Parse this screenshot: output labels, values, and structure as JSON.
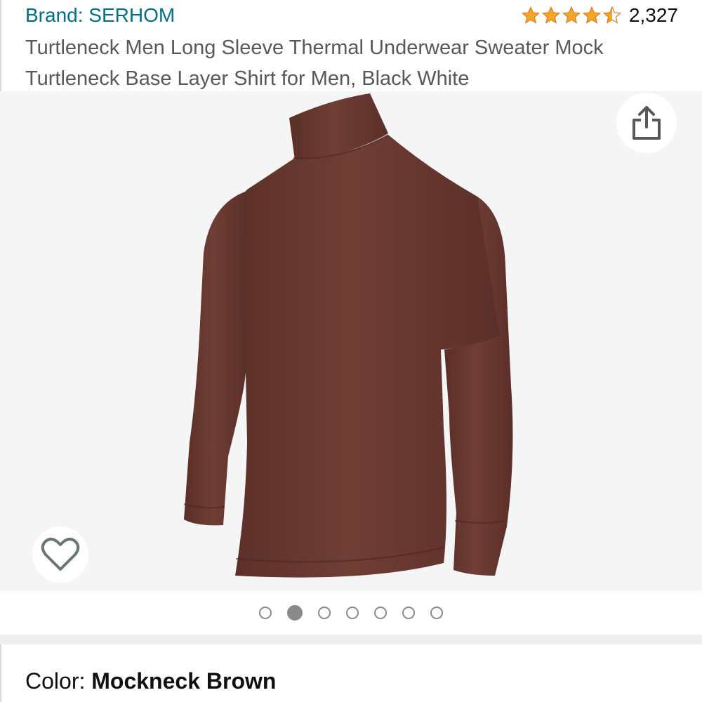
{
  "header": {
    "brand_link": "Brand: SERHOM",
    "rating": {
      "stars": 4.5,
      "max_stars": 5,
      "count": "2,327"
    },
    "product_title": "Turtleneck Men Long Sleeve Thermal Underwear Sweater Mock Turtleneck Base Layer Shirt for Men, Black White"
  },
  "gallery": {
    "share_icon": "share-icon",
    "wishlist_icon": "heart-outline-icon",
    "image_count": 7,
    "active_index": 1,
    "shirt_color": "#6b3b32"
  },
  "color_selection": {
    "label": "Color:",
    "value": "Mockneck Brown"
  },
  "colors": {
    "link": "#007185",
    "star": "#f5a623",
    "text": "#0f1111",
    "muted": "#565959"
  }
}
